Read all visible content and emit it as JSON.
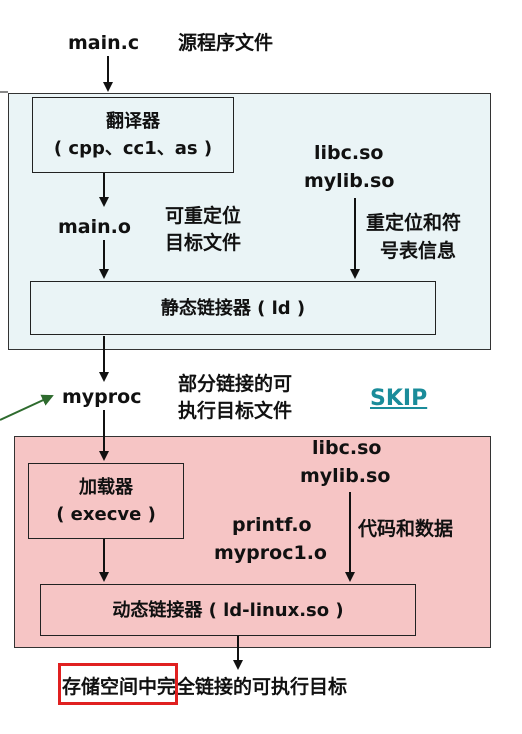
{
  "top": {
    "source_file": "main.c",
    "source_file_desc": "源程序文件"
  },
  "static_panel": {
    "color": "#eaf4f6",
    "translator_line1": "翻译器",
    "translator_line2": "( cpp、cc1、as )",
    "object_file": "main.o",
    "object_desc_line1": "可重定位",
    "object_desc_line2": "目标文件",
    "libs_line1": "libc.so",
    "libs_line2": "mylib.so",
    "reloc_line1": "重定位和符",
    "reloc_line2": "号表信息",
    "static_linker": "静态链接器 ( ld )"
  },
  "middle": {
    "partial_exec": "myproc",
    "partial_desc_line1": "部分链接的可",
    "partial_desc_line2": "执行目标文件",
    "skip_link": "SKIP",
    "arrow_color": "#2e6b2e"
  },
  "dynamic_panel": {
    "color": "#f6c5c5",
    "loader_line1": "加载器",
    "loader_line2": "( execve )",
    "libs_line1": "libc.so",
    "libs_line2": "mylib.so",
    "code_data": "代码和数据",
    "objs_line1": "printf.o",
    "objs_line2": "myproc1.o",
    "dynamic_linker": "动态链接器 ( ld-linux.so )"
  },
  "bottom": {
    "highlight": "存储空间中",
    "rest": "完全链接的可执行目标",
    "highlight_color": "#e02020"
  }
}
